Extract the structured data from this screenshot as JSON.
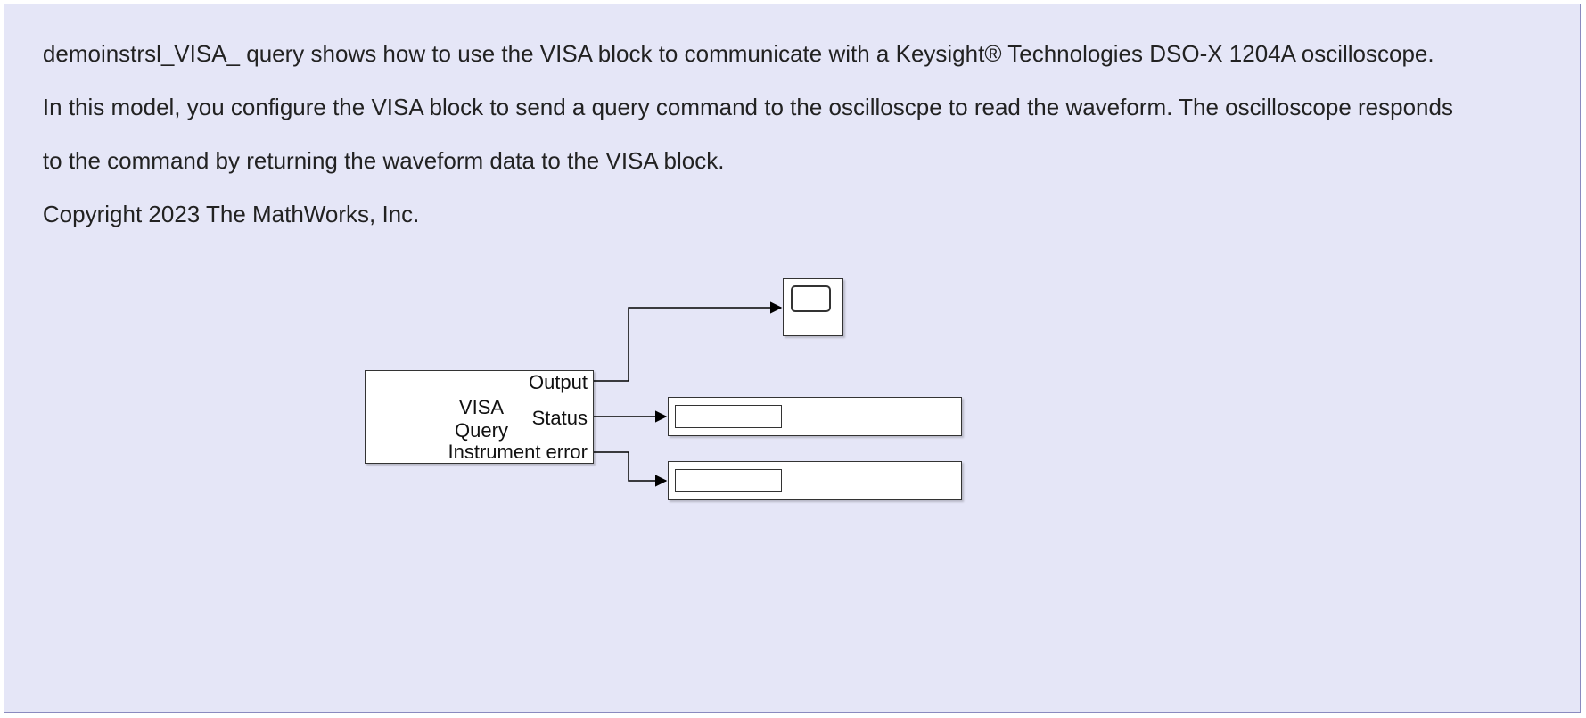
{
  "description": {
    "line1": "demoinstrsl_VISA_ query shows how to use the VISA block to communicate with a Keysight® Technologies DSO-X 1204A oscilloscope.",
    "line2": "In this model, you configure the VISA block to send a query command to the oscilloscpe to read the waveform. The oscilloscope responds",
    "line3": "to the command by returning the waveform data to the VISA block.",
    "copyright": "Copyright 2023 The MathWorks, Inc."
  },
  "visa_block": {
    "title_line1": "VISA",
    "title_line2": "Query",
    "ports": {
      "output": "Output",
      "status": "Status",
      "instrument_error": "Instrument error"
    }
  },
  "sinks": {
    "scope": "Scope",
    "status_display": "Display",
    "error_display": "Display"
  }
}
